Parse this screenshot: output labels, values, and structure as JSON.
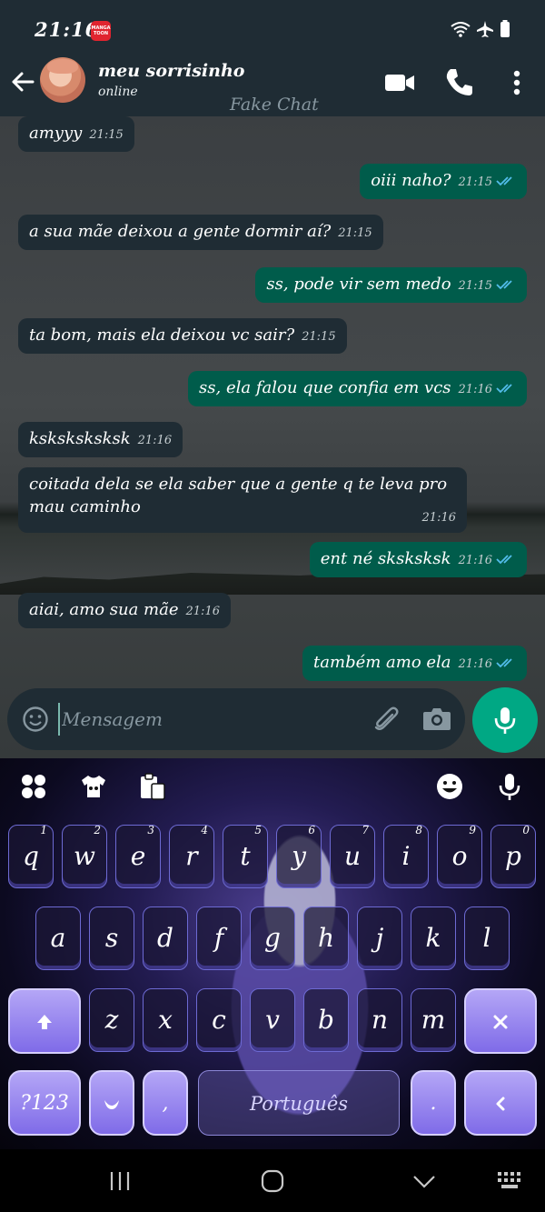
{
  "status_bar": {
    "time": "21:16",
    "app_badge": "MANGA TOON"
  },
  "header": {
    "contact_name": "meu sorrisinho",
    "contact_status": "online",
    "watermark": "Fake Chat"
  },
  "messages": [
    {
      "dir": "in",
      "text": "amyyy",
      "time": "21:15"
    },
    {
      "dir": "out",
      "text": "oiii naho?",
      "time": "21:15"
    },
    {
      "dir": "in",
      "text": "a sua mãe deixou a gente dormir aí?",
      "time": "21:15"
    },
    {
      "dir": "out",
      "text": "ss, pode vir sem medo",
      "time": "21:15"
    },
    {
      "dir": "in",
      "text": "ta bom, mais ela deixou vc sair?",
      "time": "21:15"
    },
    {
      "dir": "out",
      "text": "ss, ela falou que confia em vcs",
      "time": "21:16"
    },
    {
      "dir": "in",
      "text": "ksksksksksk",
      "time": "21:16"
    },
    {
      "dir": "in",
      "text": "coitada dela se ela saber que a gente q te leva pro mau caminho",
      "time": "21:16"
    },
    {
      "dir": "out",
      "text": "ent né sksksksk",
      "time": "21:16"
    },
    {
      "dir": "in",
      "text": "aiai, amo sua mãe",
      "time": "21:16"
    },
    {
      "dir": "out",
      "text": "também amo ela",
      "time": "21:16"
    }
  ],
  "input": {
    "placeholder": "Mensagem"
  },
  "keyboard": {
    "row1": [
      {
        "key": "q",
        "hint": "1"
      },
      {
        "key": "w",
        "hint": "2"
      },
      {
        "key": "e",
        "hint": "3"
      },
      {
        "key": "r",
        "hint": "4"
      },
      {
        "key": "t",
        "hint": "5"
      },
      {
        "key": "y",
        "hint": "6"
      },
      {
        "key": "u",
        "hint": "7"
      },
      {
        "key": "i",
        "hint": "8"
      },
      {
        "key": "o",
        "hint": "9"
      },
      {
        "key": "p",
        "hint": "0"
      }
    ],
    "row2": [
      "a",
      "s",
      "d",
      "f",
      "g",
      "h",
      "j",
      "k",
      "l"
    ],
    "row3": [
      "z",
      "x",
      "c",
      "v",
      "b",
      "n",
      "m"
    ],
    "symbols_label": "?123",
    "comma": ",",
    "period": ".",
    "space_label": "Português"
  },
  "colors": {
    "incoming": "#1f2c34",
    "outgoing": "#005c4b",
    "accent": "#00a884",
    "read_ticks": "#53bdeb"
  }
}
